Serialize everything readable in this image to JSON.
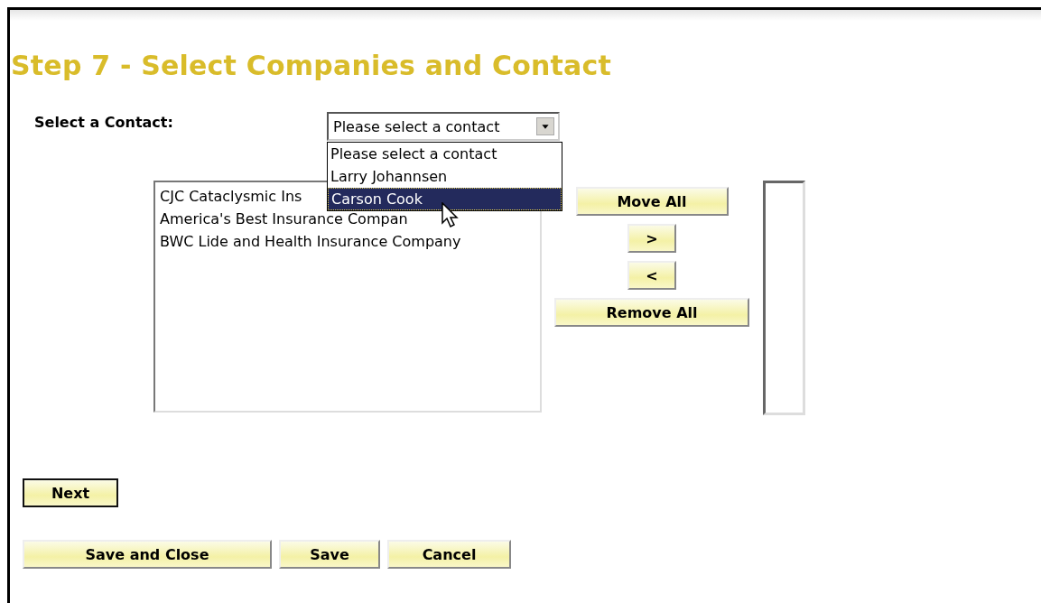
{
  "title": "Step 7 - Select Companies and Contact",
  "contact": {
    "label": "Select a Contact:",
    "value": "Please select a contact",
    "expanded": true,
    "options": [
      {
        "label": "Please select a contact",
        "highlighted": false
      },
      {
        "label": "Larry Johannsen",
        "highlighted": false
      },
      {
        "label": "Carson Cook",
        "highlighted": true
      }
    ]
  },
  "available_companies": [
    "CJC Cataclysmic Ins",
    "America's Best Insurance Compan",
    "BWC Lide and Health Insurance Company"
  ],
  "move_buttons": [
    {
      "label": "Move All",
      "kind": "wide"
    },
    {
      "label": ">",
      "kind": "small"
    },
    {
      "label": "<",
      "kind": "small"
    },
    {
      "label": "Remove All",
      "kind": "wider"
    }
  ],
  "next_button": "Next",
  "footer_buttons": [
    {
      "label": "Save and Close",
      "kind": "save-close"
    },
    {
      "label": "Save",
      "kind": "save"
    },
    {
      "label": "Cancel",
      "kind": "cancel"
    }
  ]
}
